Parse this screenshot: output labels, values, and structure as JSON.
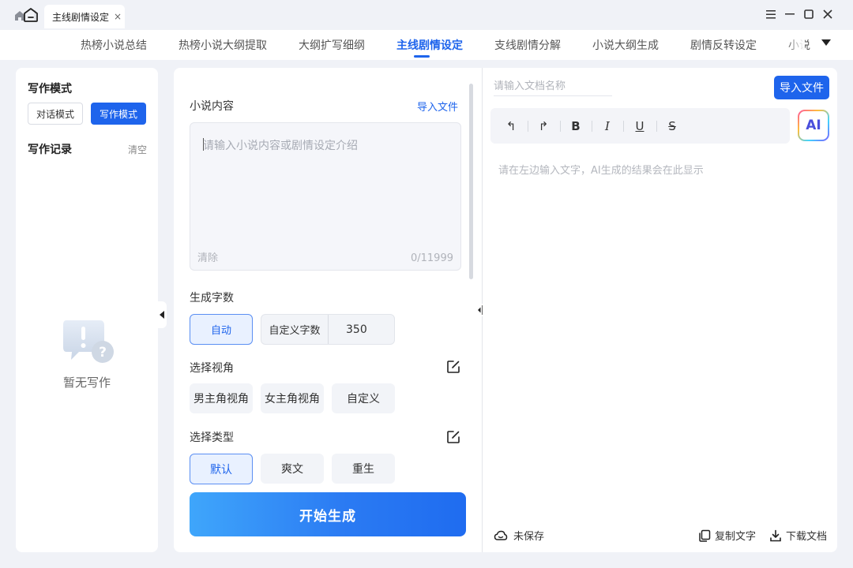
{
  "window": {
    "tab_title": "主线剧情设定",
    "tab_close": "×"
  },
  "nav": {
    "items": [
      "热榜小说总结",
      "热榜小说大纲提取",
      "大纲扩写细纲",
      "主线剧情设定",
      "支线剧情分解",
      "小说大纲生成",
      "剧情反转设定",
      "小说"
    ],
    "active_index": 3
  },
  "left_panel": {
    "mode_title": "写作模式",
    "mode_buttons": [
      "对话模式",
      "写作模式"
    ],
    "selected_mode": "写作模式",
    "history_title": "写作记录",
    "clear_label": "清空",
    "empty_text": "暂无写作"
  },
  "middle_panel": {
    "content_label": "小说内容",
    "import_label": "导入文件",
    "textarea_placeholder": "请输入小说内容或剧情设定介绍",
    "clear_label": "清除",
    "char_count": "0/11999",
    "word_count_label": "生成字数",
    "word_count_auto": "自动",
    "word_count_custom_label": "自定义字数",
    "word_count_value": "350",
    "perspective_label": "选择视角",
    "perspective_options": [
      "男主角视角",
      "女主角视角",
      "自定义"
    ],
    "type_label": "选择类型",
    "type_options": [
      "默认",
      "爽文",
      "重生"
    ],
    "selected_type": "默认",
    "generate_label": "开始生成"
  },
  "right_panel": {
    "doc_name_placeholder": "请输入文档名称",
    "import_label": "导入文件",
    "toolbar": {
      "undo": "↰",
      "redo": "↱",
      "bold": "B",
      "italic": "I",
      "underline": "U",
      "strike": "S"
    },
    "ai_label": "AI",
    "output_placeholder": "请在左边输入文字，AI生成的结果会在此显示",
    "save_status": "未保存",
    "copy_label": "复制文字",
    "download_label": "下载文档"
  },
  "colors": {
    "accent": "#1e64ec",
    "background": "#f0f2f7"
  }
}
